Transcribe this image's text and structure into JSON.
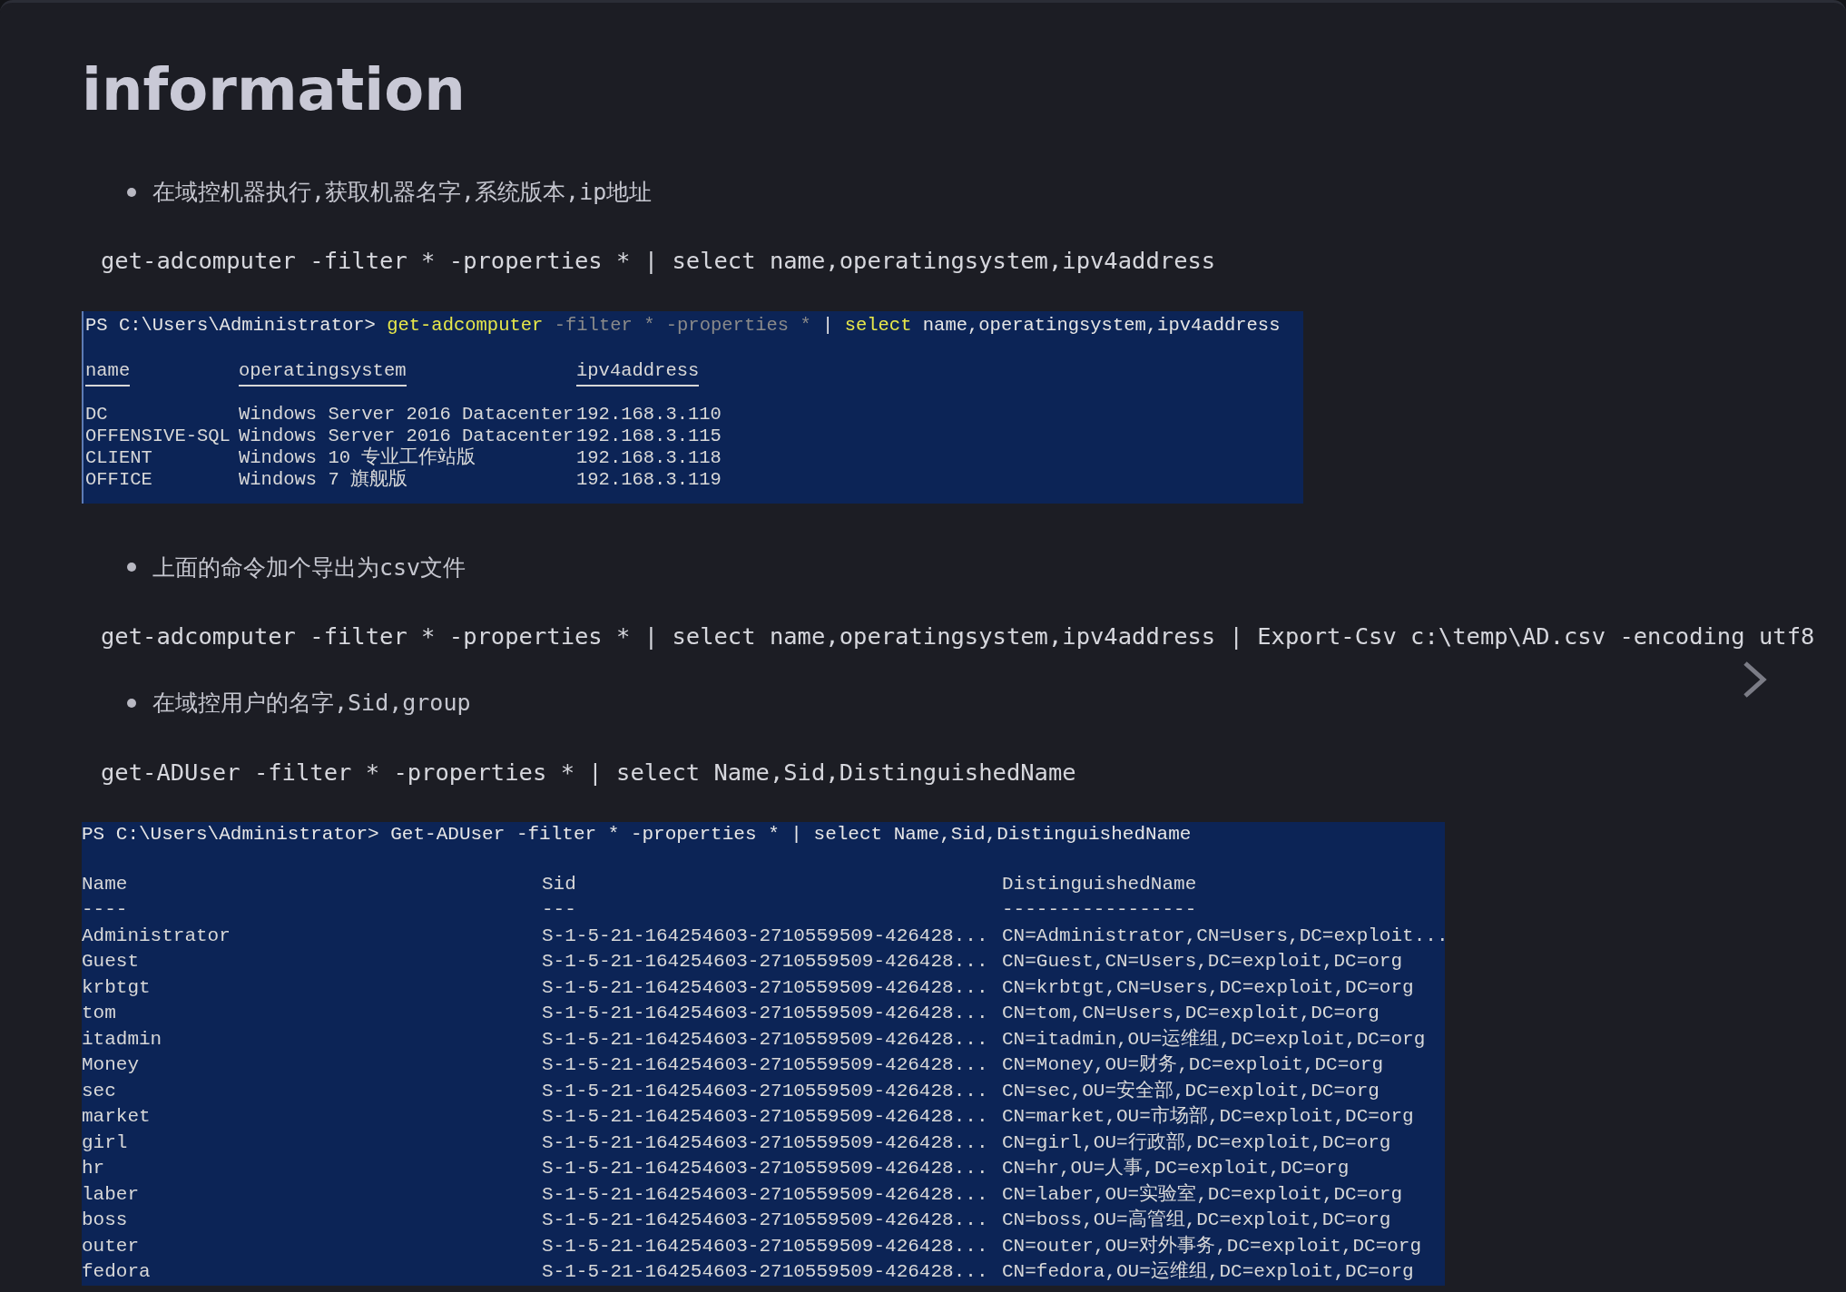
{
  "heading": "information",
  "blocks": [
    {
      "kind": "bullet",
      "text": "在域控机器执行,获取机器名字,系统版本,ip地址"
    },
    {
      "kind": "code",
      "text": "get-adcomputer -filter * -properties * | select name,operatingsystem,ipv4address"
    },
    {
      "kind": "terminal",
      "headers_underlined": true,
      "prompt": "PS C:\\Users\\Administrator>",
      "command": [
        {
          "kind": "cmdlet",
          "text": "get-adcomputer"
        },
        {
          "kind": "param",
          "text": "-filter"
        },
        {
          "kind": "param",
          "text": "*"
        },
        {
          "kind": "param",
          "text": "-properties"
        },
        {
          "kind": "param",
          "text": "*"
        },
        {
          "kind": "plain",
          "text": "|"
        },
        {
          "kind": "cmdlet",
          "text": "select"
        },
        {
          "kind": "plain",
          "text": "name,operatingsystem,ipv4address"
        }
      ],
      "columns": [
        {
          "label": "name"
        },
        {
          "label": "operatingsystem"
        },
        {
          "label": "ipv4address"
        }
      ],
      "rows": [
        [
          "DC",
          "Windows Server 2016 Datacenter",
          "192.168.3.110"
        ],
        [
          "OFFENSIVE-SQL",
          "Windows Server 2016 Datacenter",
          "192.168.3.115"
        ],
        [
          "CLIENT",
          "Windows 10 专业工作站版",
          "192.168.3.118"
        ],
        [
          "OFFICE",
          "Windows 7 旗舰版",
          "192.168.3.119"
        ]
      ]
    },
    {
      "kind": "bullet",
      "text": "上面的命令加个导出为csv文件"
    },
    {
      "kind": "code",
      "text": "get-adcomputer -filter * -properties * | select name,operatingsystem,ipv4address | Export-Csv c:\\temp\\AD.csv -encoding utf8"
    },
    {
      "kind": "bullet",
      "text": "在域控用户的名字,Sid,group"
    },
    {
      "kind": "code",
      "text": "get-ADUser -filter * -properties * | select Name,Sid,DistinguishedName"
    },
    {
      "kind": "terminal",
      "headers_underlined": false,
      "prompt": "PS C:\\Users\\Administrator>",
      "command": [
        {
          "kind": "plain",
          "text": "Get-ADUser -filter * -properties * | select Name,Sid,DistinguishedName"
        }
      ],
      "columns": [
        {
          "label": "Name",
          "dashes": "----"
        },
        {
          "label": "Sid",
          "dashes": "---"
        },
        {
          "label": "DistinguishedName",
          "dashes": "-----------------"
        }
      ],
      "rows": [
        [
          "Administrator",
          "S-1-5-21-164254603-2710559509-426428...",
          "CN=Administrator,CN=Users,DC=exploit..."
        ],
        [
          "Guest",
          "S-1-5-21-164254603-2710559509-426428...",
          "CN=Guest,CN=Users,DC=exploit,DC=org"
        ],
        [
          "krbtgt",
          "S-1-5-21-164254603-2710559509-426428...",
          "CN=krbtgt,CN=Users,DC=exploit,DC=org"
        ],
        [
          "tom",
          "S-1-5-21-164254603-2710559509-426428...",
          "CN=tom,CN=Users,DC=exploit,DC=org"
        ],
        [
          "itadmin",
          "S-1-5-21-164254603-2710559509-426428...",
          "CN=itadmin,OU=运维组,DC=exploit,DC=org"
        ],
        [
          "Money",
          "S-1-5-21-164254603-2710559509-426428...",
          "CN=Money,OU=财务,DC=exploit,DC=org"
        ],
        [
          "sec",
          "S-1-5-21-164254603-2710559509-426428...",
          "CN=sec,OU=安全部,DC=exploit,DC=org"
        ],
        [
          "market",
          "S-1-5-21-164254603-2710559509-426428...",
          "CN=market,OU=市场部,DC=exploit,DC=org"
        ],
        [
          "girl",
          "S-1-5-21-164254603-2710559509-426428...",
          "CN=girl,OU=行政部,DC=exploit,DC=org"
        ],
        [
          "hr",
          "S-1-5-21-164254603-2710559509-426428...",
          "CN=hr,OU=人事,DC=exploit,DC=org"
        ],
        [
          "laber",
          "S-1-5-21-164254603-2710559509-426428...",
          "CN=laber,OU=实验室,DC=exploit,DC=org"
        ],
        [
          "boss",
          "S-1-5-21-164254603-2710559509-426428...",
          "CN=boss,OU=高管组,DC=exploit,DC=org"
        ],
        [
          "outer",
          "S-1-5-21-164254603-2710559509-426428...",
          "CN=outer,OU=对外事务,DC=exploit,DC=org"
        ],
        [
          "fedora",
          "S-1-5-21-164254603-2710559509-426428...",
          "CN=fedora,OU=运维组,DC=exploit,DC=org"
        ]
      ]
    }
  ]
}
